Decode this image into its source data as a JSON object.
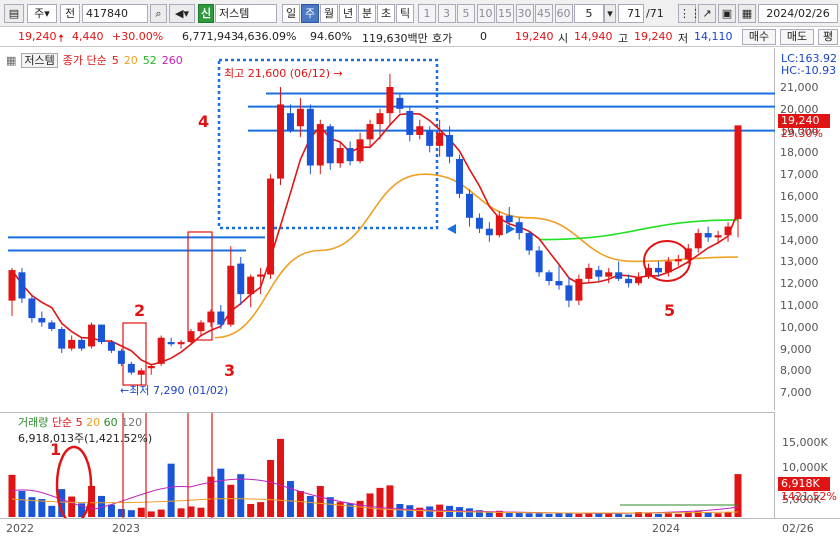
{
  "toolbar": {
    "period_select": "주",
    "mode_select": "전",
    "code": "417840",
    "credit_badge": "신",
    "name": "저스템",
    "periods": [
      "일",
      "주",
      "월",
      "년",
      "분",
      "초",
      "틱"
    ],
    "active_period": "주",
    "intervals": [
      "1",
      "3",
      "5",
      "10",
      "15",
      "30",
      "45",
      "60"
    ],
    "interval_value": "5",
    "page_value": "71",
    "page_total": "/71",
    "date": "2024/02/26"
  },
  "quote": {
    "price": "19,240",
    "change": "4,440",
    "change_pct": "+30.00%",
    "volume": "6,771,943",
    "volume_pct": "4,636.09%",
    "ratio": "94.60%",
    "amount": "119,630백만",
    "hoga_label": "호가",
    "hoga_value": "0",
    "hoga_price": "19,240",
    "open_label": "시",
    "open": "14,940",
    "high_label": "고",
    "high": "19,240",
    "low_label": "저",
    "low": "14,110",
    "buy_label": "매수",
    "sell_label": "매도",
    "eval_label": "평"
  },
  "legend": {
    "name": "저스템",
    "ma_label": "종가 단순",
    "ma_periods": [
      "5",
      "20",
      "52",
      "260"
    ],
    "ma_colors": [
      "#e01414",
      "#f0a020",
      "#22b822",
      "#c020c0"
    ]
  },
  "price_axis": {
    "ticks": [
      "21,000",
      "20,000",
      "19,000",
      "18,000",
      "17,000",
      "16,000",
      "15,000",
      "14,000",
      "13,000",
      "12,000",
      "11,000",
      "10,000",
      "9,000",
      "8,000",
      "7,000"
    ],
    "lc": "LC:163.92",
    "hc": "HC:-10.93",
    "current": "19,240",
    "current_pct": "29.30%"
  },
  "annotations": {
    "high_marker": "최고 21,600 (06/12)",
    "low_marker": "최저 7,290 (01/02)",
    "labels": [
      "1",
      "2",
      "3",
      "4",
      "5"
    ]
  },
  "volume": {
    "legend_label": "거래량",
    "ma_label": "단순",
    "ma_periods": [
      "5",
      "20",
      "60",
      "120"
    ],
    "current_text": "6,918,013주(1,421.52%)",
    "ticks": [
      "15,000K",
      "10,000K",
      "5,000K"
    ],
    "current_tag": "6,918K",
    "current_pct": "1421.52%"
  },
  "x_axis": {
    "labels": [
      "2022",
      "2023",
      "2024",
      "02/26"
    ]
  },
  "chart_data": {
    "type": "line",
    "title": "",
    "xlabel": "",
    "ylabel": "",
    "ylim": [
      7000,
      21000
    ],
    "x": [
      "2022",
      "2023",
      "2024"
    ],
    "series": [
      {
        "name": "5",
        "values": [
          11800,
          8200,
          15500,
          21600,
          18000,
          14000,
          12200,
          12800,
          19240
        ]
      },
      {
        "name": "20",
        "values": [
          9500,
          13500,
          17000,
          15000,
          13000,
          13200
        ]
      },
      {
        "name": "52",
        "values": [
          14000,
          14900
        ]
      }
    ],
    "volume_current": 6918
  }
}
